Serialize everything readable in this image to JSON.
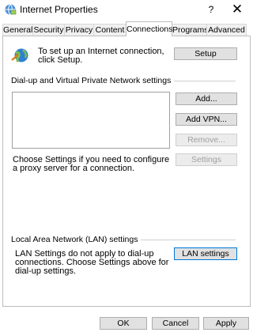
{
  "window": {
    "title": "Internet Properties",
    "help_label": "?",
    "close_label": "✕"
  },
  "tabs": [
    {
      "label": "General",
      "active": false
    },
    {
      "label": "Security",
      "active": false
    },
    {
      "label": "Privacy",
      "active": false
    },
    {
      "label": "Content",
      "active": false
    },
    {
      "label": "Connections",
      "active": true
    },
    {
      "label": "Programs",
      "active": false
    },
    {
      "label": "Advanced",
      "active": false
    }
  ],
  "setup_section": {
    "text": "To set up an Internet connection, click Setup.",
    "button": "Setup"
  },
  "dialup_section": {
    "header": "Dial-up and Virtual Private Network settings",
    "list_items": [],
    "add_button": "Add...",
    "add_vpn_button": "Add VPN...",
    "remove_button": "Remove...",
    "settings_button": "Settings",
    "proxy_text": "Choose Settings if you need to configure a proxy server for a connection."
  },
  "lan_section": {
    "header": "Local Area Network (LAN) settings",
    "text": "LAN Settings do not apply to dial-up connections. Choose Settings above for dial-up settings.",
    "button": "LAN settings"
  },
  "footer": {
    "ok": "OK",
    "cancel": "Cancel",
    "apply": "Apply"
  },
  "colors": {
    "accent": "#0078d7",
    "disabled_text": "#a0a0a0"
  }
}
